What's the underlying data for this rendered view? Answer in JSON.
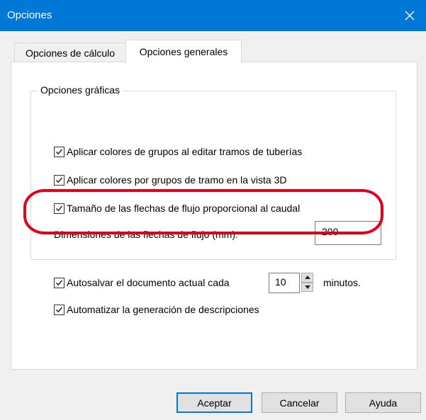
{
  "window": {
    "title": "Opciones"
  },
  "tabs": [
    {
      "label": "Opciones de cálculo",
      "active": false
    },
    {
      "label": "Opciones generales",
      "active": true
    }
  ],
  "group": {
    "legend": "Opciones gráficas",
    "items": [
      {
        "label": "Aplicar colores de grupos al editar tramos de tuberías",
        "checked": true
      },
      {
        "label": "Aplicar colores por grupos de tramo en la vista 3D",
        "checked": true
      },
      {
        "label": "Tamaño de las flechas de flujo proporcional al caudal",
        "checked": true
      }
    ],
    "arrow_size": {
      "label": "Dimensiones de las flechas de flujo (mm):",
      "value": "200"
    }
  },
  "autosave": {
    "label": "Autosalvar el documento actual cada",
    "value": "10",
    "suffix": "minutos.",
    "checked": true
  },
  "auto_desc": {
    "label": "Automatizar la generación de descripciones",
    "checked": true
  },
  "buttons": {
    "ok": "Aceptar",
    "cancel": "Cancelar",
    "help": "Ayuda"
  },
  "colors": {
    "titlebar": "#0078d7",
    "highlight": "#e3001b"
  }
}
